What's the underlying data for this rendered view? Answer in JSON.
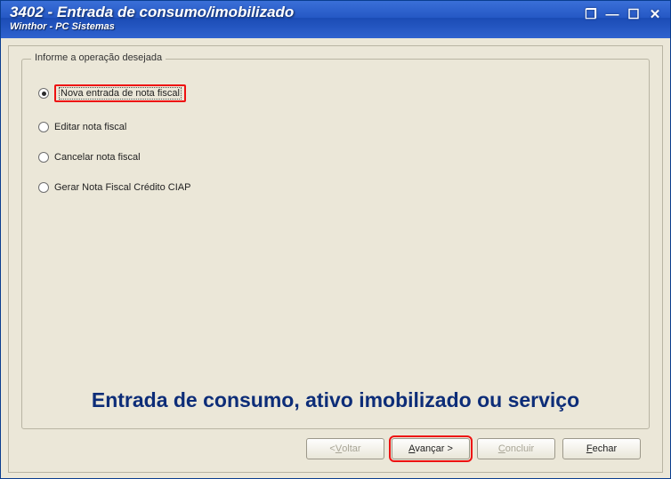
{
  "window": {
    "title": "3402 - Entrada de consumo/imobilizado",
    "subtitle": "Winthor - PC Sistemas"
  },
  "titlebar_controls": {
    "restore": "❐",
    "minimize": "—",
    "maximize": "☐",
    "close": "✕"
  },
  "groupbox": {
    "legend": "Informe a operação desejada",
    "options": [
      {
        "label": "Nova entrada de nota fiscal",
        "selected": true,
        "highlighted": true
      },
      {
        "label": "Editar nota fiscal",
        "selected": false,
        "highlighted": false
      },
      {
        "label": "Cancelar nota fiscal",
        "selected": false,
        "highlighted": false
      },
      {
        "label": "Gerar Nota Fiscal Crédito CIAP",
        "selected": false,
        "highlighted": false
      }
    ]
  },
  "banner": "Entrada de consumo, ativo imobilizado ou serviço",
  "buttons": {
    "back_prefix": "< ",
    "back_u": "V",
    "back_rest": "oltar",
    "next_u": "A",
    "next_rest": "vançar >",
    "finish_u": "C",
    "finish_rest": "oncluir",
    "close_u": "F",
    "close_rest": "echar"
  }
}
